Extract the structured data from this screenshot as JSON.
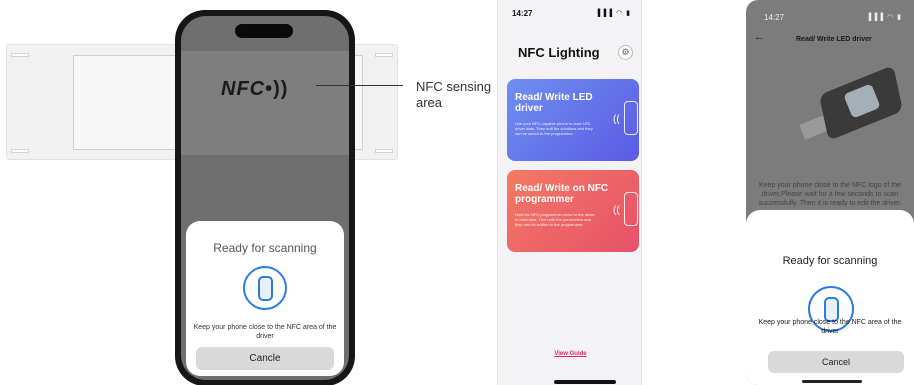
{
  "panel1": {
    "nfc_logo": "NFC",
    "nfc_waves": "•))",
    "sheet_title": "Ready for scanning",
    "sheet_message": "Keep your phone close to the NFC area of the driver",
    "cancel_label": "Cancle",
    "callout_label": "NFC sensing area"
  },
  "panel2": {
    "time": "14:27",
    "status_icons": "▐▐▐ ◠ ▮",
    "title": "NFC Lighting",
    "settings_icon": "⚙",
    "card1": {
      "title": "Read/ Write LED driver",
      "desc": "Use your NFC-capable phone to read LED driver data. Then edit the solutions and they can be saved to the programmer."
    },
    "card2": {
      "title": "Read/ Write on NFC programmer",
      "desc": "Hold the NFC programmer close to the driver to read data. Then edit the parameters and they can be written to the programmer."
    },
    "nfc_waves": "((",
    "view_guide": "View Guide"
  },
  "panel3": {
    "time": "14:27",
    "status_icons": "▐▐▐ ◠ ▮",
    "back_icon": "←",
    "nav_title": "Read/ Write LED driver",
    "instruction": "Keep your phone close to the NFC logo of the driver.Please wait for a few seconds to scan successfully. Then it is ready to edit the driver.",
    "sheet_title": "Ready for scanning",
    "sheet_message": "Keep your phone close to the NFC area of the driver",
    "cancel_label": "Cancel"
  },
  "colors": {
    "accent_blue": "#2d7be0",
    "card1_gradient": [
      "#6f8ff0",
      "#5b5be3"
    ],
    "card2_gradient": [
      "#f27a63",
      "#e8506a"
    ],
    "guide_link": "#e0245e"
  }
}
